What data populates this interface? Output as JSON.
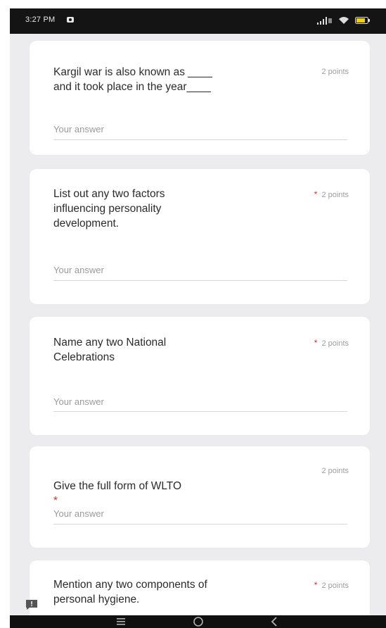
{
  "status_bar": {
    "time": "3:27 PM"
  },
  "questions": [
    {
      "text": "Kargil war is also known as ____\nand it took place in the year____",
      "required": false,
      "points": "2 points",
      "answer_placeholder": "Your answer"
    },
    {
      "text": "List out any two factors\ninfluencing personality\ndevelopment.",
      "required": true,
      "points": "2 points",
      "answer_placeholder": "Your answer"
    },
    {
      "text": "Name any two National\nCelebrations",
      "required": true,
      "points": "2 points",
      "answer_placeholder": "Your answer"
    },
    {
      "text": "Give the full form of WLTO",
      "inline_star": "*",
      "points": "2 points",
      "answer_placeholder": "Your answer"
    },
    {
      "text": "Mention any two components of\npersonal hygiene.",
      "required": true,
      "points": "2 points"
    }
  ],
  "colors": {
    "background": "#ececef",
    "card": "#ffffff",
    "required_star": "#d93025",
    "status_bar": "#141414"
  },
  "icons": {
    "notification": "notification-icon",
    "signal": "signal-icon",
    "wifi": "wifi-icon",
    "battery": "battery-icon",
    "feedback": "feedback-icon",
    "nav_menu": "menu-icon",
    "nav_home": "home-icon",
    "nav_back": "back-icon"
  }
}
